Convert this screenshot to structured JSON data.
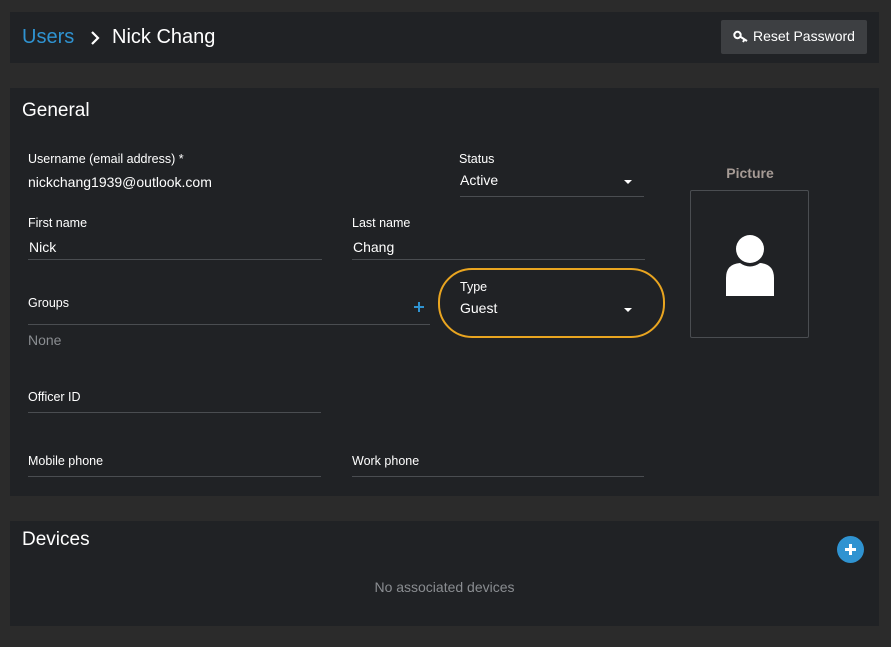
{
  "breadcrumb": {
    "parent": "Users",
    "current": "Nick Chang"
  },
  "header": {
    "reset_password_label": "Reset Password"
  },
  "general": {
    "title": "General",
    "username": {
      "label": "Username (email address) *",
      "value": "nickchang1939@outlook.com"
    },
    "status": {
      "label": "Status",
      "value": "Active"
    },
    "first_name": {
      "label": "First name",
      "value": "Nick"
    },
    "last_name": {
      "label": "Last name",
      "value": "Chang"
    },
    "groups": {
      "label": "Groups",
      "value": "None"
    },
    "type": {
      "label": "Type",
      "value": "Guest"
    },
    "officer_id": {
      "label": "Officer ID",
      "value": ""
    },
    "mobile_phone": {
      "label": "Mobile phone",
      "value": ""
    },
    "work_phone": {
      "label": "Work phone",
      "value": ""
    },
    "picture": {
      "label": "Picture"
    }
  },
  "devices": {
    "title": "Devices",
    "empty_message": "No associated devices"
  },
  "colors": {
    "accent": "#2f93d1",
    "highlight": "#e9a520",
    "panel": "#202225",
    "background": "#2b2b2b"
  }
}
